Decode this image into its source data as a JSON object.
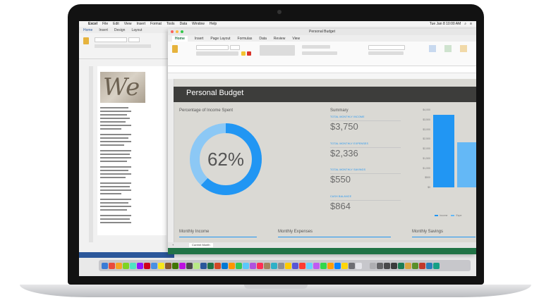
{
  "menubar": {
    "app": "Excel",
    "items": [
      "File",
      "Edit",
      "View",
      "Insert",
      "Format",
      "Tools",
      "Data",
      "Window",
      "Help"
    ],
    "clock": "Tue Jan 8  10:00 AM"
  },
  "word": {
    "tabs": [
      "Home",
      "Insert",
      "Design",
      "Layout"
    ],
    "image_text": "We"
  },
  "excel": {
    "window_title": "Personal Budget",
    "tabs": [
      "Home",
      "Insert",
      "Page Layout",
      "Formulas",
      "Data",
      "Review",
      "View"
    ],
    "sheet_title": "Personal Budget",
    "percent_label": "Percentage of Income Spent",
    "percent_value": "62%",
    "percent_fraction": 0.62,
    "summary_label": "Summary",
    "summary": [
      {
        "label": "TOTAL MONTHLY INCOME",
        "value": "$3,750"
      },
      {
        "label": "TOTAL MONTHLY EXPENSES",
        "value": "$2,336"
      },
      {
        "label": "TOTAL MONTHLY SAVINGS",
        "value": "$550"
      },
      {
        "label": "CASH BALANCE",
        "value": "$864"
      }
    ],
    "sections": [
      "Monthly Income",
      "Monthly Expenses",
      "Monthly Savings"
    ],
    "sheet_tab": "Current Month",
    "accent": "#2196f3",
    "status_color": "#217346"
  },
  "chart_data": {
    "type": "bar",
    "categories": [
      "Income",
      "Expenses"
    ],
    "series": [
      {
        "values": [
          3750,
          2336
        ]
      }
    ],
    "ylim": [
      0,
      4000
    ],
    "yticks": [
      "$4,000",
      "$3,500",
      "$3,000",
      "$2,500",
      "$2,000",
      "$1,500",
      "$1,000",
      "$500",
      "$0"
    ],
    "legend": [
      "Income",
      "Expe"
    ]
  }
}
